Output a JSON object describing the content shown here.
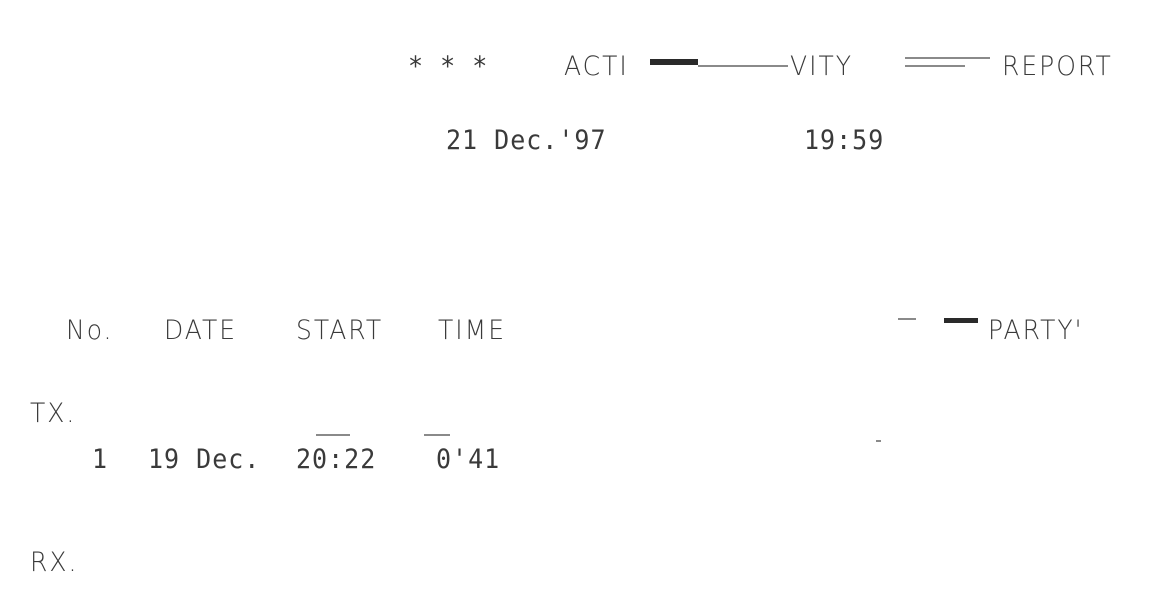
{
  "header": {
    "stars": "* * *",
    "title_a": "ACTI",
    "title_b": "VITY",
    "title_c": "REPORT",
    "date": "21 Dec.'97",
    "time": "19:59"
  },
  "columns": {
    "no": "No.",
    "date": "DATE",
    "start": "START",
    "time": "TIME",
    "party": "PARTY'"
  },
  "sections": {
    "tx_label": "TX.",
    "rx_label": "RX."
  },
  "tx_rows": [
    {
      "no": "1",
      "date": "19 Dec.",
      "start": "20:22",
      "time": "0'41"
    }
  ]
}
